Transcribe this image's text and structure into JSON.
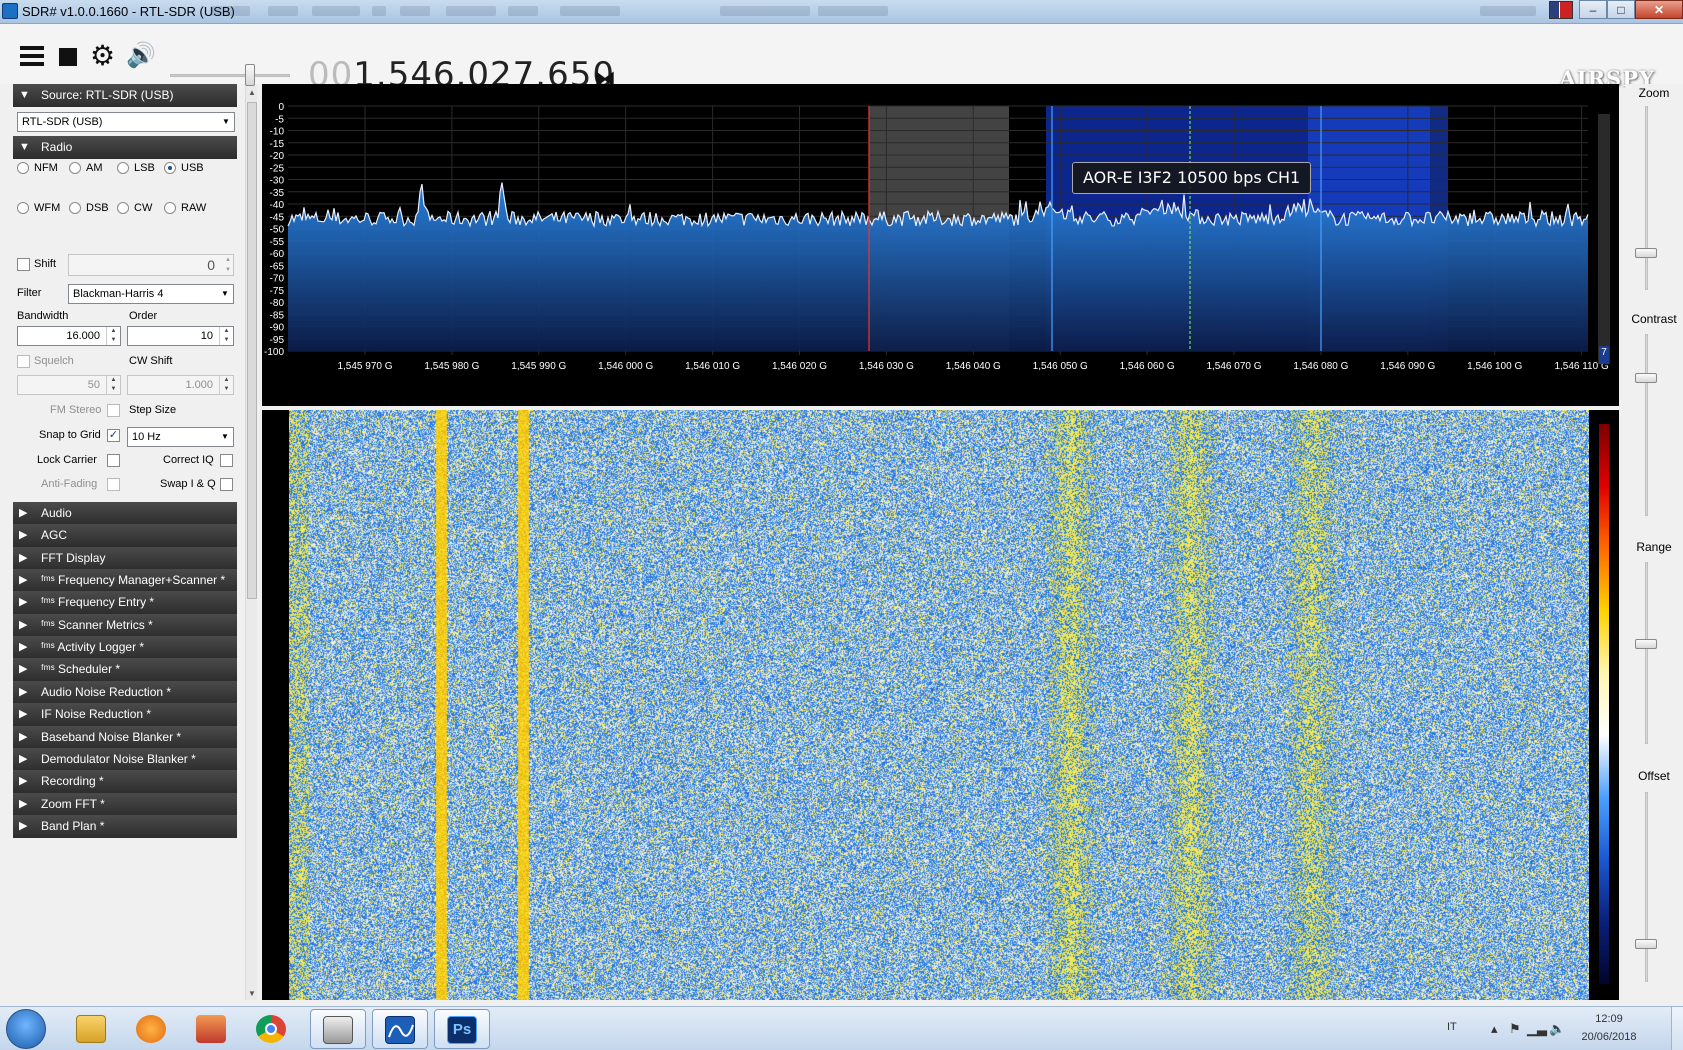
{
  "window": {
    "title": "SDR# v1.0.0.1660 - RTL-SDR (USB)"
  },
  "toolbar": {
    "menu_icon": "hamburger-menu-icon",
    "stop_icon": "stop-icon",
    "settings_icon": "gear-icon",
    "audio_icon": "speaker-icon",
    "volume_fraction": 0.68,
    "frequency_leading": "00",
    "frequency_main": "1.546.027.650",
    "logo": "AIRSPY"
  },
  "sidebar": {
    "source": {
      "header": "Source: RTL-SDR (USB)",
      "device": "RTL-SDR (USB)"
    },
    "radio": {
      "header": "Radio",
      "modes_row1": [
        "NFM",
        "AM",
        "LSB",
        "USB"
      ],
      "modes_row2": [
        "WFM",
        "DSB",
        "CW",
        "RAW"
      ],
      "selected_mode": "USB",
      "shift_label": "Shift",
      "shift_value": "0",
      "filter_label": "Filter",
      "filter_value": "Blackman-Harris 4",
      "bandwidth_label": "Bandwidth",
      "bandwidth_value": "16.000",
      "order_label": "Order",
      "order_value": "10",
      "squelch_label": "Squelch",
      "squelch_value": "50",
      "cwshift_label": "CW Shift",
      "cwshift_value": "1.000",
      "fmstereo_label": "FM Stereo",
      "stepsize_label": "Step Size",
      "snap_label": "Snap to Grid",
      "snap_checked": true,
      "step_value": "10 Hz",
      "lockcarrier_label": "Lock Carrier",
      "correctiq_label": "Correct IQ",
      "antifading_label": "Anti-Fading",
      "swapiq_label": "Swap I & Q"
    },
    "plugins": [
      "Audio",
      "AGC",
      "FFT Display",
      "ᶠᵐˢ Frequency Manager+Scanner *",
      "ᶠᵐˢ Frequency Entry *",
      "ᶠᵐˢ Scanner Metrics *",
      "ᶠᵐˢ Activity Logger *",
      "ᶠᵐˢ Scheduler *",
      "Audio Noise Reduction *",
      "IF Noise Reduction *",
      "Baseband Noise Blanker *",
      "Demodulator Noise Blanker *",
      "Recording *",
      "Zoom FFT *",
      "Band Plan *"
    ]
  },
  "spectrum": {
    "db_labels": [
      "0",
      "-5",
      "-10",
      "-15",
      "-20",
      "-25",
      "-30",
      "-35",
      "-40",
      "-45",
      "-50",
      "-55",
      "-60",
      "-65",
      "-70",
      "-75",
      "-80",
      "-85",
      "-90",
      "-95",
      "-100"
    ],
    "freq_labels": [
      "1,545 970 G",
      "1,545 980 G",
      "1,545 990 G",
      "1,546 000 G",
      "1,546 010 G",
      "1,546 020 G",
      "1,546 030 G",
      "1,546 040 G",
      "1,546 050 G",
      "1,546 060 G",
      "1,546 070 G",
      "1,546 080 G",
      "1,546 090 G",
      "1,546 100 G",
      "1,546 110 G"
    ],
    "tooltip": "AOR-E I3F2 10500 bps CH1",
    "scale_value": "7"
  },
  "right_panel": {
    "zoom": "Zoom",
    "contrast": "Contrast",
    "range": "Range",
    "offset": "Offset",
    "zoom_fraction": 0.0,
    "contrast_fraction": 0.24,
    "range_fraction": 0.45,
    "offset_fraction": 0.0
  },
  "taskbar": {
    "apps": [
      "start-orb",
      "file-explorer-icon",
      "media-player-icon",
      "app-icon",
      "chrome-icon",
      "printer-app-icon",
      "sdrsharp-icon",
      "photoshop-icon"
    ],
    "ps_label": "Ps",
    "lang": "IT",
    "time": "12:09",
    "date": "20/06/2018"
  },
  "colors": {
    "header_dark": "#2d2d2d",
    "spectrum_blue": "#1565c0",
    "waterfall_yellow": "#f2e91a",
    "waterfall_blue": "#1b6fd1",
    "cursor_red": "#e53935",
    "cursor_green": "#7cd957"
  }
}
